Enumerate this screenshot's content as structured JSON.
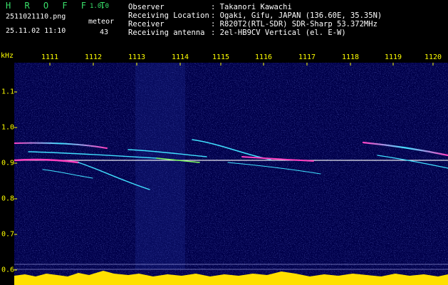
{
  "app": {
    "title": "H R O F F T",
    "version": "1.0.0"
  },
  "capture": {
    "file_name": "2511021110.png",
    "date_time": "25.11.02 11:10",
    "meteor_label": "meteor",
    "meteor_count": "43"
  },
  "info": {
    "rows": [
      {
        "key": "Observer",
        "value": ": Takanori Kawachi"
      },
      {
        "key": "Receiving Location",
        "value": ": Ogaki, Gifu, JAPAN (136.60E, 35.35N)"
      },
      {
        "key": "Receiver",
        "value": ": R820T2(RTL-SDR) SDR-Sharp 53.372MHz"
      },
      {
        "key": "Receiving antenna",
        "value": ": 2el-HB9CV Vertical (el. E-W)"
      }
    ]
  },
  "axes": {
    "y_unit": "kHz",
    "y_ticks": [
      "1.1",
      "1.0",
      "0.9",
      "0.8",
      "0.7",
      "0.6"
    ],
    "x_ticks": [
      "1111",
      "1112",
      "1113",
      "1114",
      "1115",
      "1116",
      "1117",
      "1118",
      "1119",
      "1120"
    ]
  },
  "colors": {
    "background": "#000000",
    "spectrogram_bg": "#000050",
    "axis_text": "#ffff00",
    "title_green": "#39e06a",
    "carrier": "#ffffff",
    "trace_cyan": "#40e0ff",
    "trace_magenta": "#ff40c0",
    "level_bar_yellow": "#ffe000",
    "level_bar_cyan": "#00d8ff"
  }
}
